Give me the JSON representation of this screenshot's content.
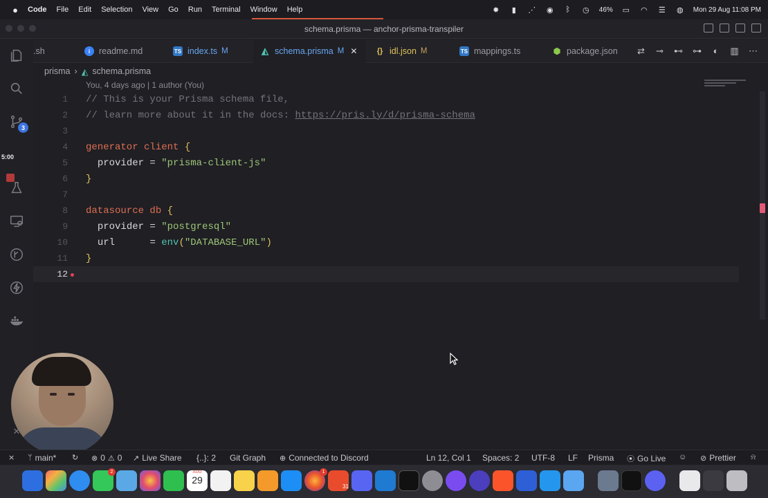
{
  "menubar": {
    "app": "Code",
    "menus": [
      "File",
      "Edit",
      "Selection",
      "View",
      "Go",
      "Run",
      "Terminal",
      "Window",
      "Help"
    ],
    "battery": "46%",
    "datetime": "Mon 29 Aug  11:08 PM"
  },
  "window": {
    "title": "schema.prisma — anchor-prisma-transpiler"
  },
  "activity": {
    "scm_badge": "3",
    "timer": "5:00"
  },
  "tabs": [
    {
      "label": ".sh",
      "modified": ""
    },
    {
      "label": "readme.md",
      "modified": ""
    },
    {
      "label": "index.ts",
      "modified": "M"
    },
    {
      "label": "schema.prisma",
      "modified": "M"
    },
    {
      "label": "idl.json",
      "modified": "M"
    },
    {
      "label": "mappings.ts",
      "modified": ""
    },
    {
      "label": "package.json",
      "modified": ""
    }
  ],
  "tab_icons": {
    "readme": "info-icon",
    "index": "ts-icon",
    "schema": "prisma-icon",
    "idl": "json-braces-icon",
    "mappings": "ts-icon",
    "package": "nodejs-icon"
  },
  "breadcrumb": {
    "folder": "prisma",
    "file": "schema.prisma"
  },
  "blame": "You, 4 days ago | 1 author (You)",
  "code": {
    "line_numbers": [
      "1",
      "2",
      "3",
      "4",
      "5",
      "6",
      "7",
      "8",
      "9",
      "10",
      "11",
      "12"
    ],
    "l1": "// This is your Prisma schema file,",
    "l2_comment": "// learn more about it in the docs: ",
    "l2_link": "https://pris.ly/d/prisma-schema",
    "l4_kw": "generator",
    "l4_name": "client",
    "open_brace": "{",
    "close_brace": "}",
    "l5_prop": "provider",
    "eq": " = ",
    "l5_val": "\"prisma-client-js\"",
    "l8_kw": "datasource",
    "l8_name": "db",
    "l9_prop": "provider",
    "l9_val": "\"postgresql\"",
    "l10_prop": "url",
    "l10_eq": "      = ",
    "l10_fn": "env",
    "l10_paren_open": "(",
    "l10_val": "\"DATABASE_URL\"",
    "l10_paren_close": ")"
  },
  "status": {
    "branch": "main*",
    "problems": "0",
    "warnings": "0",
    "live_share": "Live Share",
    "braces": "{..}: 2",
    "git_graph": "Git Graph",
    "discord": "Connected to Discord",
    "position": "Ln 12, Col 1",
    "spaces": "Spaces: 2",
    "encoding": "UTF-8",
    "eol": "LF",
    "language": "Prisma",
    "go_live": "Go Live",
    "prettier": "Prettier"
  },
  "dock": {
    "messages_badge": "2",
    "calendar_month": "AUG",
    "calendar_day": "29",
    "app_badge": "1",
    "app2_day": "31"
  },
  "colors": {
    "accent_blue": "#6aa6ef",
    "keyword": "#de6f52",
    "string": "#9fc677",
    "brace": "#e2c35a",
    "progress": "#d7553c"
  }
}
